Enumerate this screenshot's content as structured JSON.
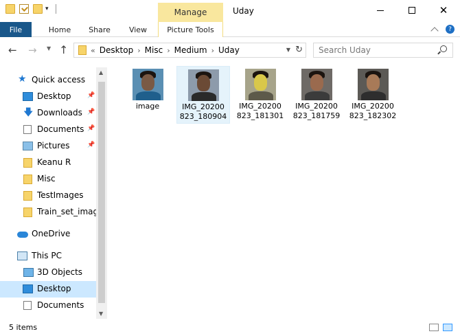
{
  "title_bar": {
    "title": "Uday",
    "manage_tab": "Manage",
    "quick_access_icons": [
      "folder-icon",
      "properties-icon",
      "new-folder-icon"
    ],
    "controls": [
      "minimize",
      "maximize",
      "close"
    ]
  },
  "ribbon": {
    "tabs": [
      "File",
      "Home",
      "Share",
      "View",
      "Picture Tools"
    ],
    "help": "?"
  },
  "nav": {
    "back": "←",
    "forward": "→",
    "recent_dropdown": "⌄",
    "up": "↑",
    "address_lead": "«",
    "breadcrumbs": [
      "Desktop",
      "Misc",
      "Medium",
      "Uday"
    ],
    "crumb_separator": "›",
    "search_placeholder": "Search Uday"
  },
  "sidebar": {
    "quick_access": "Quick access",
    "pinned": [
      {
        "label": "Desktop",
        "icon": "desktop-icon"
      },
      {
        "label": "Downloads",
        "icon": "download-icon"
      },
      {
        "label": "Documents",
        "icon": "documents-icon"
      },
      {
        "label": "Pictures",
        "icon": "pictures-icon"
      }
    ],
    "folders": [
      "Keanu R",
      "Misc",
      "TestImages",
      "Train_set_images"
    ],
    "onedrive": "OneDrive",
    "this_pc": "This PC",
    "pc_items": [
      "3D Objects",
      "Desktop",
      "Documents"
    ],
    "selected": "Desktop"
  },
  "files": [
    {
      "line1": "image",
      "line2": "",
      "selected": false
    },
    {
      "line1": "IMG_20200",
      "line2": "823_180904",
      "selected": true
    },
    {
      "line1": "IMG_20200",
      "line2": "823_181301",
      "selected": false
    },
    {
      "line1": "IMG_20200",
      "line2": "823_181759",
      "selected": false
    },
    {
      "line1": "IMG_20200",
      "line2": "823_182302",
      "selected": false
    }
  ],
  "status": {
    "item_count": "5 items",
    "view_modes": [
      "details-view",
      "large-icons-view"
    ],
    "active_view": "large-icons-view"
  },
  "colors": {
    "file_tab": "#19578a",
    "manage_tab": "#f9e79e",
    "selection": "#cce8ff",
    "accent": "#1f78d1"
  }
}
